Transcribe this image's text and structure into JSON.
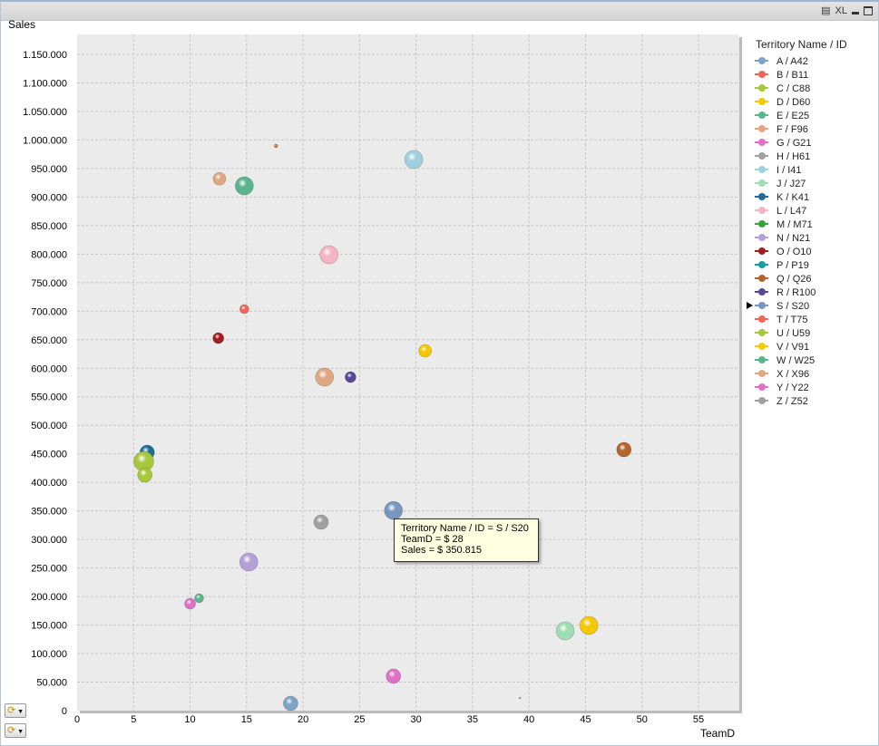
{
  "window": {
    "icons": [
      "print-icon",
      "excel-icon",
      "minimize-icon",
      "maximize-icon"
    ],
    "xl_label": "XL"
  },
  "chart_data": {
    "type": "scatter",
    "xlabel": "TeamD",
    "ylabel": "Sales",
    "xlim": [
      0,
      58.6
    ],
    "ylim": [
      0,
      1185000
    ],
    "x_ticks": [
      0,
      5,
      10,
      15,
      20,
      25,
      30,
      35,
      40,
      45,
      50,
      55
    ],
    "y_ticks": [
      "0",
      "50.000",
      "100.000",
      "150.000",
      "200.000",
      "250.000",
      "300.000",
      "350.000",
      "400.000",
      "450.000",
      "500.000",
      "550.000",
      "600.000",
      "650.000",
      "700.000",
      "750.000",
      "800.000",
      "850.000",
      "900.000",
      "950.000",
      "1.000.000",
      "1.050.000",
      "1.100.000",
      "1.150.000"
    ],
    "grid": true,
    "legend_title": "Territory Name / ID",
    "legend_placement": "right",
    "legend": [
      {
        "label": "A / A42",
        "color": "#7ea3c8"
      },
      {
        "label": "B / B11",
        "color": "#f0645a"
      },
      {
        "label": "C / C88",
        "color": "#a8c83c"
      },
      {
        "label": "D / D60",
        "color": "#f5c800"
      },
      {
        "label": "E / E25",
        "color": "#5ab48c"
      },
      {
        "label": "F / F96",
        "color": "#e0a882"
      },
      {
        "label": "G / G21",
        "color": "#e070c8"
      },
      {
        "label": "H / H61",
        "color": "#a0a0a0"
      },
      {
        "label": "I / I41",
        "color": "#a0d0e0"
      },
      {
        "label": "J / J27",
        "color": "#a0dcb4"
      },
      {
        "label": "K / K41",
        "color": "#1e6e96"
      },
      {
        "label": "L / L47",
        "color": "#f4b4c4"
      },
      {
        "label": "M / M71",
        "color": "#3ca03c"
      },
      {
        "label": "N / N21",
        "color": "#b4a0d8"
      },
      {
        "label": "O / O10",
        "color": "#a01e1e"
      },
      {
        "label": "P / P19",
        "color": "#14a0a0"
      },
      {
        "label": "Q / Q26",
        "color": "#b4642d"
      },
      {
        "label": "R / R100",
        "color": "#5a4696"
      },
      {
        "label": "S / S20",
        "color": "#7896be",
        "selected": true
      },
      {
        "label": "T / T75",
        "color": "#f0645a"
      },
      {
        "label": "U / U59",
        "color": "#a8c83c"
      },
      {
        "label": "V / V91",
        "color": "#f5c800"
      },
      {
        "label": "W / W25",
        "color": "#5ab48c"
      },
      {
        "label": "X / X96",
        "color": "#e0a882"
      },
      {
        "label": "Y / Y22",
        "color": "#e070c8"
      },
      {
        "label": "Z / Z52",
        "color": "#a0a0a0"
      }
    ],
    "points": [
      {
        "id": "T",
        "x": 17.6,
        "y": 989500,
        "size": 2,
        "color": "#c8783c"
      },
      {
        "id": "I",
        "x": 29.8,
        "y": 965800,
        "size": 10,
        "color": "#a0d0e0"
      },
      {
        "id": "F",
        "x": 12.6,
        "y": 932000,
        "size": 7,
        "color": "#e0a882"
      },
      {
        "id": "E",
        "x": 14.8,
        "y": 919600,
        "size": 10,
        "color": "#5ab48c"
      },
      {
        "id": "L",
        "x": 22.3,
        "y": 798900,
        "size": 10,
        "color": "#f4b4c4"
      },
      {
        "id": "B",
        "x": 14.8,
        "y": 703600,
        "size": 5,
        "color": "#f0645a"
      },
      {
        "id": "O",
        "x": 12.5,
        "y": 652800,
        "size": 6,
        "color": "#a01e1e"
      },
      {
        "id": "D",
        "x": 30.8,
        "y": 630600,
        "size": 7,
        "color": "#f5c800"
      },
      {
        "id": "X",
        "x": 21.9,
        "y": 584500,
        "size": 10,
        "color": "#e0a882"
      },
      {
        "id": "R",
        "x": 24.2,
        "y": 584500,
        "size": 6,
        "color": "#5a4696"
      },
      {
        "id": "Q",
        "x": 48.4,
        "y": 457400,
        "size": 8,
        "color": "#b4642d"
      },
      {
        "id": "K",
        "x": 6.2,
        "y": 452700,
        "size": 8,
        "color": "#1e6e96"
      },
      {
        "id": "C",
        "x": 5.9,
        "y": 436800,
        "size": 11,
        "color": "#a8c83c"
      },
      {
        "id": "U",
        "x": 6.0,
        "y": 413000,
        "size": 8,
        "color": "#a8c83c"
      },
      {
        "id": "S",
        "x": 28,
        "y": 350815,
        "size": 10,
        "color": "#7896be"
      },
      {
        "id": "H",
        "x": 21.6,
        "y": 330400,
        "size": 8,
        "color": "#a0a0a0"
      },
      {
        "id": "N",
        "x": 15.2,
        "y": 260500,
        "size": 10,
        "color": "#b4a0d8"
      },
      {
        "id": "W",
        "x": 10.8,
        "y": 197000,
        "size": 5,
        "color": "#5ab48c"
      },
      {
        "id": "G",
        "x": 10.0,
        "y": 187400,
        "size": 6,
        "color": "#e070c8"
      },
      {
        "id": "J",
        "x": 43.2,
        "y": 139800,
        "size": 10,
        "color": "#a0dcb4"
      },
      {
        "id": "V",
        "x": 45.3,
        "y": 149300,
        "size": 10,
        "color": "#f5c800"
      },
      {
        "id": "Y",
        "x": 28.0,
        "y": 60400,
        "size": 8,
        "color": "#e070c8"
      },
      {
        "id": "A",
        "x": 18.9,
        "y": 12700,
        "size": 8,
        "color": "#7ea3c8"
      },
      {
        "id": "Z",
        "x": 39.2,
        "y": 22200,
        "size": 1,
        "color": "#a0a0a0"
      }
    ],
    "tooltip": {
      "line1": "Territory Name / ID = S / S20",
      "line2": "TeamD = $ 28",
      "line3": "Sales = $ 350.815"
    }
  }
}
